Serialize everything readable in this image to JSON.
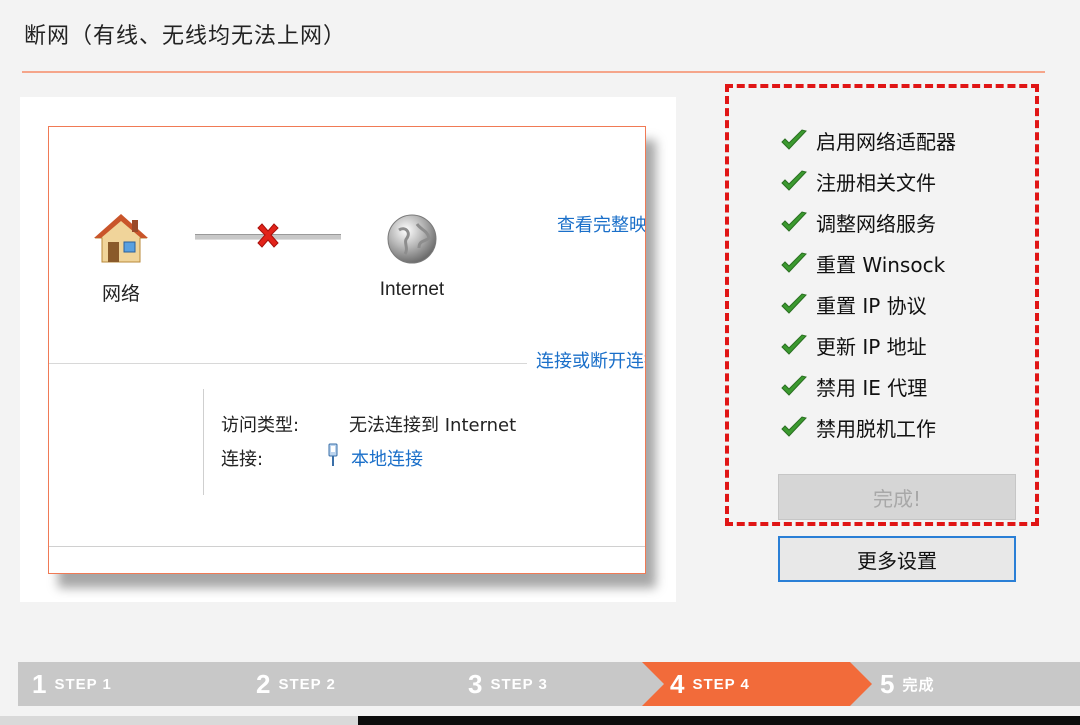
{
  "header": {
    "title": "断网（有线、无线均无法上网）"
  },
  "network_window": {
    "node_network_label": "网络",
    "node_internet_label": "Internet",
    "view_full_link": "查看完整映射",
    "connect_link": "连接或断开连接",
    "access_type_key": "访问类型:",
    "access_type_value": "无法连接到 Internet",
    "connection_key": "连接:",
    "connection_value": "本地连接"
  },
  "checklist": {
    "items": [
      {
        "label": "启用网络适配器",
        "icon": "check-icon"
      },
      {
        "label": "注册相关文件",
        "icon": "check-icon"
      },
      {
        "label": "调整网络服务",
        "icon": "check-icon"
      },
      {
        "label": "重置 Winsock",
        "icon": "check-icon"
      },
      {
        "label": "重置 IP 协议",
        "icon": "check-icon"
      },
      {
        "label": "更新 IP 地址",
        "icon": "check-icon"
      },
      {
        "label": "禁用 IE 代理",
        "icon": "check-icon"
      },
      {
        "label": "禁用脱机工作",
        "icon": "check-icon"
      }
    ],
    "done_button": "完成!",
    "more_button": "更多设置"
  },
  "steps": [
    {
      "num": "1",
      "label": "STEP 1",
      "state": "inactive"
    },
    {
      "num": "2",
      "label": "STEP 2",
      "state": "inactive"
    },
    {
      "num": "3",
      "label": "STEP 3",
      "state": "inactive"
    },
    {
      "num": "4",
      "label": "STEP 4",
      "state": "active"
    },
    {
      "num": "5",
      "label": "完成",
      "state": "inactive"
    }
  ],
  "colors": {
    "accent": "#f26b3a",
    "step_inactive": "#c8c8c8",
    "highlight_border": "#e01515",
    "link": "#1a6fc9",
    "check": "#3b9a2f"
  }
}
